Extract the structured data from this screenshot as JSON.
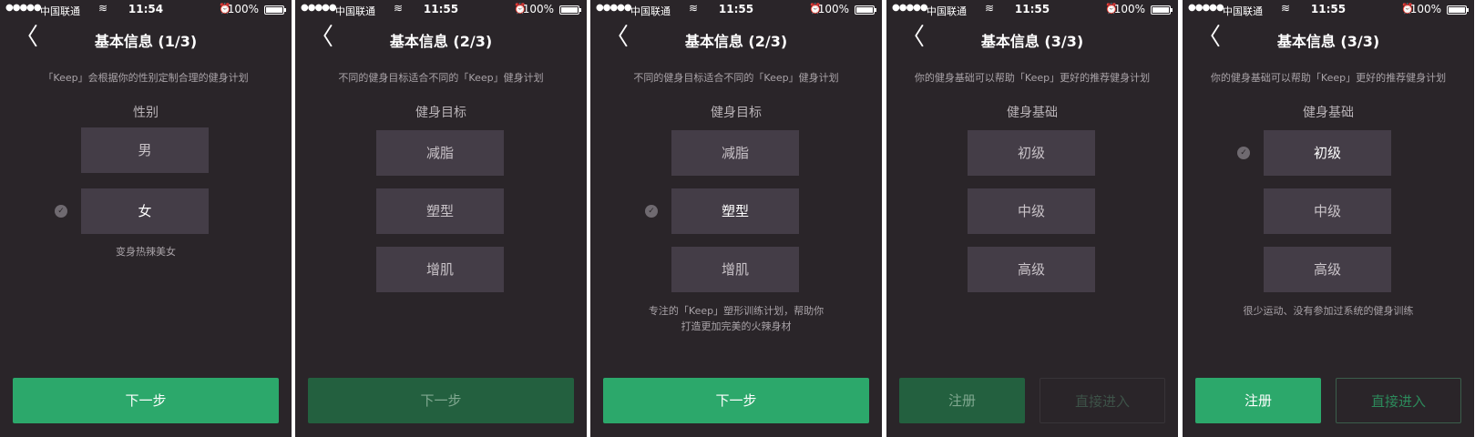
{
  "status": {
    "signal": "●●●●●",
    "carrier": "中国联通",
    "battery": "100%"
  },
  "screens": [
    {
      "time": "11:54",
      "title": "基本信息 (1/3)",
      "subtitle": "「Keep」会根据你的性别定制合理的健身计划",
      "section": "性别",
      "options": [
        "男",
        "女"
      ],
      "selected_index": 1,
      "description": "变身热辣美女",
      "next_label": "下一步"
    },
    {
      "time": "11:55",
      "title": "基本信息 (2/3)",
      "subtitle": "不同的健身目标适合不同的「Keep」健身计划",
      "section": "健身目标",
      "options": [
        "减脂",
        "塑型",
        "增肌"
      ],
      "selected_index": null,
      "description": "",
      "next_label": "下一步"
    },
    {
      "time": "11:55",
      "title": "基本信息 (2/3)",
      "subtitle": "不同的健身目标适合不同的「Keep」健身计划",
      "section": "健身目标",
      "options": [
        "减脂",
        "塑型",
        "增肌"
      ],
      "selected_index": 1,
      "description": "专注的「Keep」塑形训练计划，帮助你打造更加完美的火辣身材",
      "next_label": "下一步"
    },
    {
      "time": "11:55",
      "title": "基本信息 (3/3)",
      "subtitle": "你的健身基础可以帮助「Keep」更好的推荐健身计划",
      "section": "健身基础",
      "options": [
        "初级",
        "中级",
        "高级"
      ],
      "selected_index": null,
      "description": "",
      "register_label": "注册",
      "enter_label": "直接进入"
    },
    {
      "time": "11:55",
      "title": "基本信息 (3/3)",
      "subtitle": "你的健身基础可以帮助「Keep」更好的推荐健身计划",
      "section": "健身基础",
      "options": [
        "初级",
        "中级",
        "高级"
      ],
      "selected_index": 0,
      "description": "很少运动、没有参加过系统的健身训练",
      "register_label": "注册",
      "enter_label": "直接进入"
    }
  ],
  "colors": {
    "background": "#2a2529",
    "option_bg": "#443d47",
    "accent": "#2ca86b",
    "accent_disabled": "#23603f"
  },
  "icons": {
    "back": "chevron-left-icon",
    "check": "check-circle-icon",
    "wifi": "wifi-icon",
    "alarm": "alarm-clock-icon",
    "battery": "battery-icon"
  }
}
